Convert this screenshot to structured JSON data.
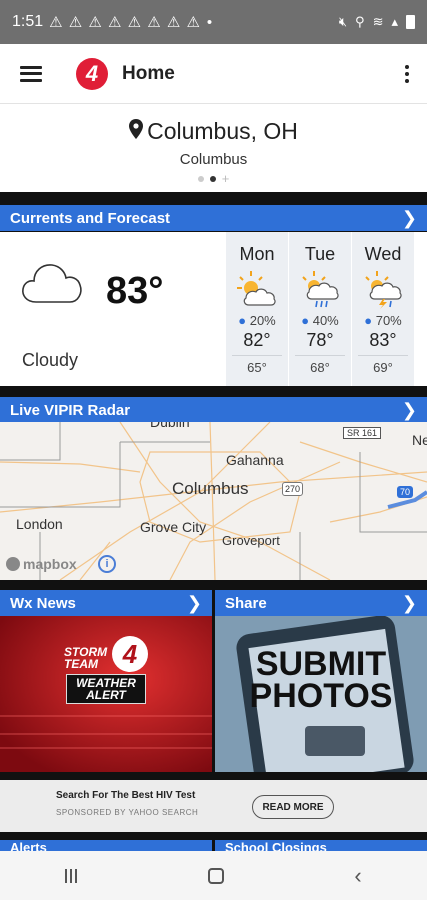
{
  "status_bar": {
    "time": "1:51",
    "notification_icons": "⚠ ⚠ ⚠ ⚠ ⚠ ⚠ ⚠ ⚠"
  },
  "app_bar": {
    "logo_text": "4",
    "title": "Home"
  },
  "location": {
    "name": "Columbus, OH",
    "sub": "Columbus"
  },
  "sections": {
    "currents_forecast": "Currents and Forecast",
    "radar": "Live VIPIR Radar",
    "wx_news": "Wx News",
    "share": "Share",
    "alerts": "Alerts",
    "school_closings": "School Closings"
  },
  "current": {
    "temp": "83°",
    "condition": "Cloudy"
  },
  "forecast": [
    {
      "day": "Mon",
      "precip": "20%",
      "high": "82°",
      "low": "65°"
    },
    {
      "day": "Tue",
      "precip": "40%",
      "high": "78°",
      "low": "68°"
    },
    {
      "day": "Wed",
      "precip": "70%",
      "high": "83°",
      "low": "69°"
    }
  ],
  "map": {
    "labels": {
      "columbus": "Columbus",
      "gahanna": "Gahanna",
      "grove_city": "Grove City",
      "groveport": "Groveport",
      "london": "London",
      "new_albany": "Ne",
      "sr161": "SR 161",
      "i270": "270",
      "i70": "70",
      "top_edge": "Dublin"
    },
    "attribution": "mapbox"
  },
  "tiles": {
    "storm_team_line1": "STORM",
    "storm_team_line2": "TEAM",
    "storm_team_num": "4",
    "weather_alert_line1": "WEATHER",
    "weather_alert_line2": "ALERT",
    "submit_line1": "SUBMIT",
    "submit_line2": "PHOTOS"
  },
  "promo": {
    "headline": "Search For The Best HIV Test",
    "sponsor": "SPONSORED BY YAHOO SEARCH",
    "button": "READ MORE"
  },
  "colors": {
    "header_blue": "#2f70d7",
    "brand_red": "#e01e37"
  }
}
